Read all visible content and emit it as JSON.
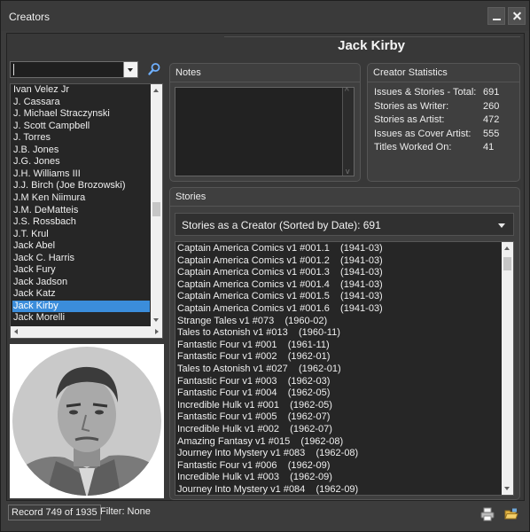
{
  "window": {
    "title": "Creators"
  },
  "header": {
    "creator_name": "Jack Kirby"
  },
  "search": {
    "value": ""
  },
  "creators": {
    "items": [
      "Ivan Velez Jr",
      "J. Cassara",
      "J. Michael Straczynski",
      "J. Scott Campbell",
      "J. Torres",
      "J.B. Jones",
      "J.G. Jones",
      "J.H. Williams III",
      "J.J. Birch (Joe Brozowski)",
      "J.M Ken Niimura",
      "J.M. DeMatteis",
      "J.S. Rossbach",
      "J.T. Krul",
      "Jack Abel",
      "Jack C. Harris",
      "Jack Fury",
      "Jack Jadson",
      "Jack Katz",
      "Jack Kirby",
      "Jack Morelli"
    ],
    "selected_index": 18,
    "scroll_position": 0.52
  },
  "notes": {
    "header": "Notes",
    "value": ""
  },
  "stats": {
    "header": "Creator Statistics",
    "rows": [
      {
        "label": "Issues & Stories - Total:",
        "value": "691"
      },
      {
        "label": "Stories as Writer:",
        "value": "260"
      },
      {
        "label": "Stories as Artist:",
        "value": "472"
      },
      {
        "label": "Issues as Cover Artist:",
        "value": "555"
      },
      {
        "label": "Titles Worked On:",
        "value": "41"
      }
    ]
  },
  "stories": {
    "header": "Stories",
    "sort_label": "Stories as a Creator (Sorted by Date): 691",
    "items": [
      "Captain America Comics v1 #001.1    (1941-03)",
      "Captain America Comics v1 #001.2    (1941-03)",
      "Captain America Comics v1 #001.3    (1941-03)",
      "Captain America Comics v1 #001.4    (1941-03)",
      "Captain America Comics v1 #001.5    (1941-03)",
      "Captain America Comics v1 #001.6    (1941-03)",
      "Strange Tales v1 #073    (1960-02)",
      "Tales to Astonish v1 #013    (1960-11)",
      "Fantastic Four v1 #001    (1961-11)",
      "Fantastic Four v1 #002    (1962-01)",
      "Tales to Astonish v1 #027    (1962-01)",
      "Fantastic Four v1 #003    (1962-03)",
      "Fantastic Four v1 #004    (1962-05)",
      "Incredible Hulk v1 #001    (1962-05)",
      "Fantastic Four v1 #005    (1962-07)",
      "Incredible Hulk v1 #002    (1962-07)",
      "Amazing Fantasy v1 #015    (1962-08)",
      "Journey Into Mystery v1 #083    (1962-08)",
      "Fantastic Four v1 #006    (1962-09)",
      "Incredible Hulk v1 #003    (1962-09)",
      "Journey Into Mystery v1 #084    (1962-09)"
    ],
    "scroll_position": 0.0
  },
  "status": {
    "record": "Record 749 of 1935",
    "filter": "Filter: None"
  }
}
